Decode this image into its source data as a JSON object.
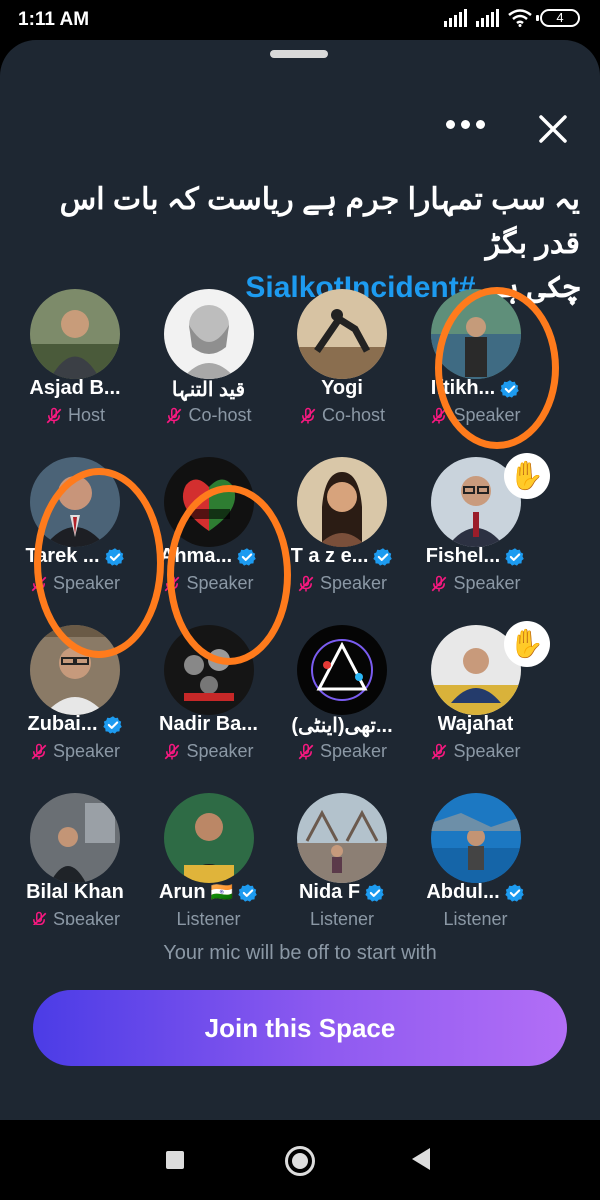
{
  "status_bar": {
    "time": "1:11 AM",
    "battery": "4"
  },
  "space": {
    "title_line1": "یہ سب تمہارا جرم ہے ریاست کہ بات اس قدر بگڑ",
    "title_line2_text": "چکی ہے",
    "hashtag": "#SialkotIncident"
  },
  "participants": [
    {
      "name": "Asjad B...",
      "role": "Host",
      "verified": false,
      "avatar": "photo-man-outdoors"
    },
    {
      "name": "قید التنہا",
      "role": "Co-host",
      "verified": false,
      "avatar": "bust-statue"
    },
    {
      "name": "Yogi",
      "role": "Co-host",
      "verified": false,
      "avatar": "yoga-silhouette"
    },
    {
      "name": "Iftikh...",
      "role": "Speaker",
      "verified": true,
      "avatar": "photo-man-lake"
    },
    {
      "name": "Tarek ...",
      "role": "Speaker",
      "verified": true,
      "avatar": "photo-man-suit"
    },
    {
      "name": "Ahma...",
      "role": "Speaker",
      "verified": true,
      "avatar": "flag-heart"
    },
    {
      "name": "T a z e...",
      "role": "Speaker",
      "verified": true,
      "avatar": "photo-woman"
    },
    {
      "name": "Fishel...",
      "role": "Speaker",
      "verified": true,
      "avatar": "photo-man-glasses",
      "hand_raised": true
    },
    {
      "name": "Zubai...",
      "role": "Speaker",
      "verified": true,
      "avatar": "photo-man-bookshelf"
    },
    {
      "name": "Nadir Ba...",
      "role": "Speaker",
      "verified": false,
      "avatar": "collage-people"
    },
    {
      "name": "(اینٹی)تھی...",
      "role": "Speaker",
      "verified": false,
      "avatar": "abstract-triangle"
    },
    {
      "name": "Wajahat",
      "role": "Speaker",
      "verified": false,
      "avatar": "photo-man-studio",
      "hand_raised": true
    },
    {
      "name": "Bilal Khan",
      "role": "Speaker",
      "verified": false,
      "avatar": "photo-man-office"
    },
    {
      "name": "Arun",
      "role": "Listener",
      "verified": true,
      "avatar": "photo-man-podium",
      "flag": "🇮🇳"
    },
    {
      "name": "Nida F",
      "role": "Listener",
      "verified": true,
      "avatar": "photo-woman-bridge"
    },
    {
      "name": "Abdul...",
      "role": "Listener",
      "verified": true,
      "avatar": "photo-man-sea"
    }
  ],
  "footer": {
    "mic_note": "Your mic will be off to start with",
    "join_label": "Join this Space"
  },
  "colors": {
    "sheet_bg": "#1e2732",
    "accent_blue": "#1d9bf0",
    "mic_off_pink": "#f91880",
    "highlight_ring": "#ff7b1c",
    "join_gradient_start": "#4b3ce6",
    "join_gradient_end": "#b26ef6"
  }
}
